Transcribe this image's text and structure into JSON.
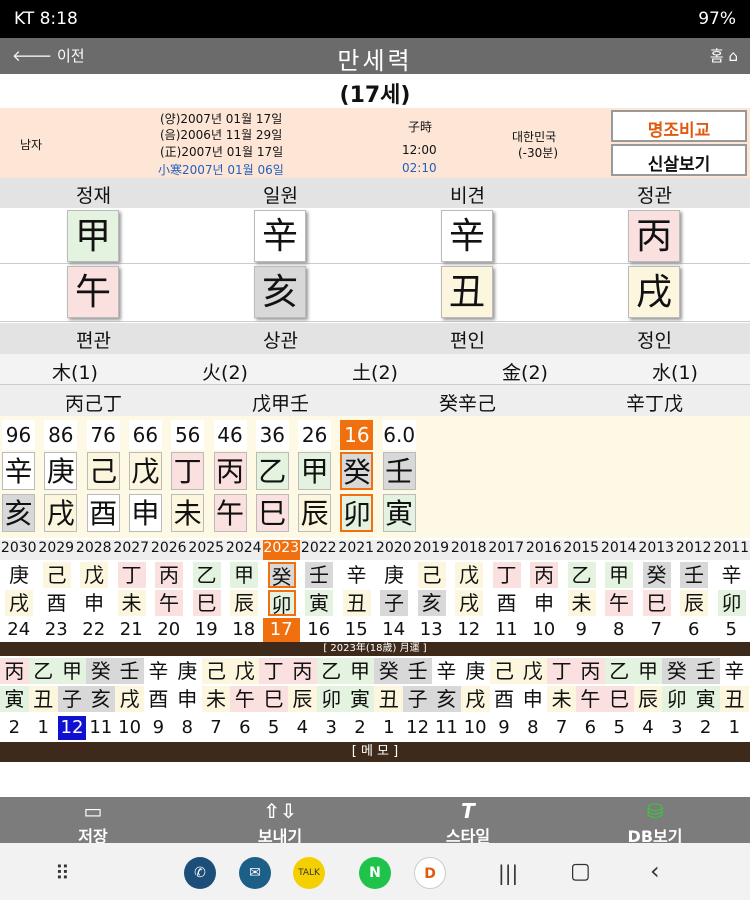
{
  "status": {
    "left": "KT 8:18",
    "right": "97%"
  },
  "header": {
    "back": "이전",
    "title": "만세력",
    "home": "홈"
  },
  "age": "(17세)",
  "info": {
    "gender": "남자",
    "solar": "(양)2007년 01월 17일",
    "lunar": "(음)2006년 11월 29일",
    "jeong": "(正)2007년 01월 17일",
    "term": "小寒2007년 01월 06일",
    "hour_label": "子時",
    "time1": "12:00",
    "time2": "02:10",
    "country": "대한민국",
    "offset": "(-30분)",
    "btn_compare": "명조비교",
    "btn_sinsal": "신살보기"
  },
  "top_labels": [
    "정재",
    "일원",
    "비견",
    "정관"
  ],
  "stems": [
    "甲",
    "辛",
    "辛",
    "丙"
  ],
  "branches": [
    "午",
    "亥",
    "丑",
    "戌"
  ],
  "bottom_labels": [
    "편관",
    "상관",
    "편인",
    "정인"
  ],
  "elements": [
    "木(1)",
    "火(2)",
    "土(2)",
    "金(2)",
    "水(1)"
  ],
  "hidden": [
    "丙己丁",
    "戊甲壬",
    "癸辛己",
    "辛丁戊"
  ],
  "daeun": {
    "nums": [
      "96",
      "86",
      "76",
      "66",
      "56",
      "46",
      "36",
      "26",
      "16",
      "6.0"
    ],
    "stems": [
      "辛",
      "庚",
      "己",
      "戊",
      "丁",
      "丙",
      "乙",
      "甲",
      "癸",
      "壬"
    ],
    "branches": [
      "亥",
      "戌",
      "酉",
      "申",
      "未",
      "午",
      "巳",
      "辰",
      "卯",
      "寅"
    ]
  },
  "years": {
    "labels": [
      "2030",
      "2029",
      "2028",
      "2027",
      "2026",
      "2025",
      "2024",
      "2023",
      "2022",
      "2021",
      "2020",
      "2019",
      "2018",
      "2017",
      "2016",
      "2015",
      "2014",
      "2013",
      "2012",
      "2011"
    ],
    "stems": [
      "庚",
      "己",
      "戊",
      "丁",
      "丙",
      "乙",
      "甲",
      "癸",
      "壬",
      "辛",
      "庚",
      "己",
      "戊",
      "丁",
      "丙",
      "乙",
      "甲",
      "癸",
      "壬",
      "辛"
    ],
    "branches": [
      "戌",
      "酉",
      "申",
      "未",
      "午",
      "巳",
      "辰",
      "卯",
      "寅",
      "丑",
      "子",
      "亥",
      "戌",
      "酉",
      "申",
      "未",
      "午",
      "巳",
      "辰",
      "卯"
    ],
    "ages": [
      "24",
      "23",
      "22",
      "21",
      "20",
      "19",
      "18",
      "17",
      "16",
      "15",
      "14",
      "13",
      "12",
      "11",
      "10",
      "9",
      "8",
      "7",
      "6",
      "5"
    ]
  },
  "year_label": "[ 2023年(18歲) 月運 ]",
  "months": {
    "stems": [
      "丙",
      "乙",
      "甲",
      "癸",
      "壬",
      "辛",
      "庚",
      "己",
      "戊",
      "丁",
      "丙",
      "乙",
      "甲",
      "癸",
      "壬",
      "辛",
      "庚",
      "己",
      "戊",
      "丁",
      "丙",
      "乙",
      "甲",
      "癸",
      "壬",
      "辛"
    ],
    "branches": [
      "寅",
      "丑",
      "子",
      "亥",
      "戌",
      "酉",
      "申",
      "未",
      "午",
      "巳",
      "辰",
      "卯",
      "寅",
      "丑",
      "子",
      "亥",
      "戌",
      "酉",
      "申",
      "未",
      "午",
      "巳",
      "辰",
      "卯",
      "寅",
      "丑"
    ],
    "nums": [
      "2",
      "1",
      "12",
      "11",
      "10",
      "9",
      "8",
      "7",
      "6",
      "5",
      "4",
      "3",
      "2",
      "1",
      "12",
      "11",
      "10",
      "9",
      "8",
      "7",
      "6",
      "5",
      "4",
      "3",
      "2",
      "1"
    ]
  },
  "memo": "[ 메 모 ]",
  "toolbar": [
    "저장",
    "보내기",
    "스타일",
    "DB보기"
  ]
}
